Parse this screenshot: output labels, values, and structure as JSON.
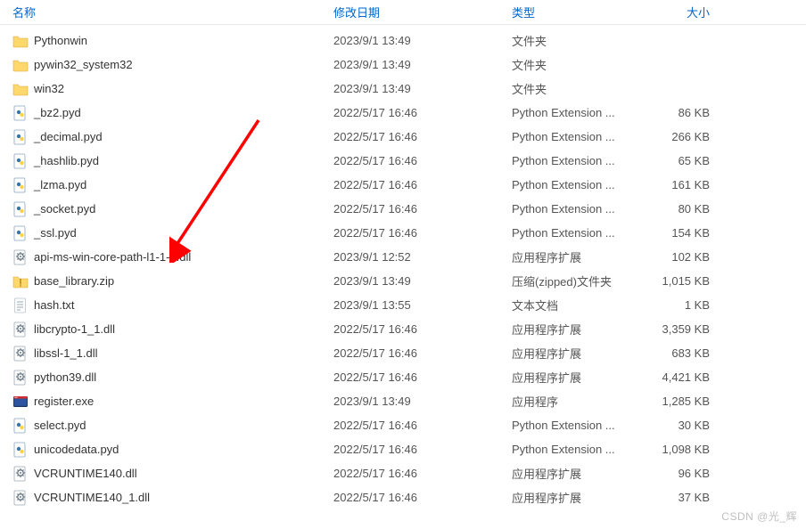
{
  "header": {
    "name": "名称",
    "date": "修改日期",
    "type": "类型",
    "size": "大小"
  },
  "icons": {
    "folder": "folder-icon",
    "pyd": "python-ext-icon",
    "dll": "dll-icon",
    "zip": "zip-icon",
    "txt": "txt-icon",
    "exe": "exe-icon"
  },
  "rows": [
    {
      "name": "Pythonwin",
      "date": "2023/9/1 13:49",
      "type": "文件夹",
      "size": "",
      "icon": "folder"
    },
    {
      "name": "pywin32_system32",
      "date": "2023/9/1 13:49",
      "type": "文件夹",
      "size": "",
      "icon": "folder"
    },
    {
      "name": "win32",
      "date": "2023/9/1 13:49",
      "type": "文件夹",
      "size": "",
      "icon": "folder"
    },
    {
      "name": "_bz2.pyd",
      "date": "2022/5/17 16:46",
      "type": "Python Extension ...",
      "size": "86 KB",
      "icon": "pyd"
    },
    {
      "name": "_decimal.pyd",
      "date": "2022/5/17 16:46",
      "type": "Python Extension ...",
      "size": "266 KB",
      "icon": "pyd"
    },
    {
      "name": "_hashlib.pyd",
      "date": "2022/5/17 16:46",
      "type": "Python Extension ...",
      "size": "65 KB",
      "icon": "pyd"
    },
    {
      "name": "_lzma.pyd",
      "date": "2022/5/17 16:46",
      "type": "Python Extension ...",
      "size": "161 KB",
      "icon": "pyd"
    },
    {
      "name": "_socket.pyd",
      "date": "2022/5/17 16:46",
      "type": "Python Extension ...",
      "size": "80 KB",
      "icon": "pyd"
    },
    {
      "name": "_ssl.pyd",
      "date": "2022/5/17 16:46",
      "type": "Python Extension ...",
      "size": "154 KB",
      "icon": "pyd"
    },
    {
      "name": "api-ms-win-core-path-l1-1-0.dll",
      "date": "2023/9/1 12:52",
      "type": "应用程序扩展",
      "size": "102 KB",
      "icon": "dll"
    },
    {
      "name": "base_library.zip",
      "date": "2023/9/1 13:49",
      "type": "压缩(zipped)文件夹",
      "size": "1,015 KB",
      "icon": "zip"
    },
    {
      "name": "hash.txt",
      "date": "2023/9/1 13:55",
      "type": "文本文档",
      "size": "1 KB",
      "icon": "txt"
    },
    {
      "name": "libcrypto-1_1.dll",
      "date": "2022/5/17 16:46",
      "type": "应用程序扩展",
      "size": "3,359 KB",
      "icon": "dll"
    },
    {
      "name": "libssl-1_1.dll",
      "date": "2022/5/17 16:46",
      "type": "应用程序扩展",
      "size": "683 KB",
      "icon": "dll"
    },
    {
      "name": "python39.dll",
      "date": "2022/5/17 16:46",
      "type": "应用程序扩展",
      "size": "4,421 KB",
      "icon": "dll"
    },
    {
      "name": "register.exe",
      "date": "2023/9/1 13:49",
      "type": "应用程序",
      "size": "1,285 KB",
      "icon": "exe"
    },
    {
      "name": "select.pyd",
      "date": "2022/5/17 16:46",
      "type": "Python Extension ...",
      "size": "30 KB",
      "icon": "pyd"
    },
    {
      "name": "unicodedata.pyd",
      "date": "2022/5/17 16:46",
      "type": "Python Extension ...",
      "size": "1,098 KB",
      "icon": "pyd"
    },
    {
      "name": "VCRUNTIME140.dll",
      "date": "2022/5/17 16:46",
      "type": "应用程序扩展",
      "size": "96 KB",
      "icon": "dll"
    },
    {
      "name": "VCRUNTIME140_1.dll",
      "date": "2022/5/17 16:46",
      "type": "应用程序扩展",
      "size": "37 KB",
      "icon": "dll"
    }
  ],
  "watermark": "CSDN @光_辉"
}
